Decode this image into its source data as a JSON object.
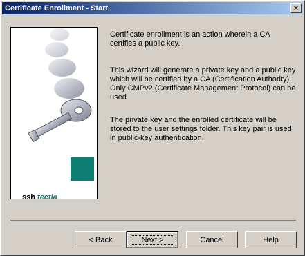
{
  "window": {
    "title": "Certificate Enrollment - Start",
    "close_label": "×"
  },
  "brand": {
    "logo_ssh": "ssh",
    "logo_tectia": "tectia"
  },
  "content": {
    "paragraphs": [
      "Certificate enrollment is an action wherein a CA certifies a public key.",
      "This wizard will generate a private key and a public key which will be certified by a CA (Certification Authority). Only CMPv2 (Certificate Management Protocol) can be used",
      "The private key and the enrolled certificate will be stored to the user settings folder. This key pair is used in public-key authentication."
    ]
  },
  "buttons": {
    "back_label": "< Back",
    "next_label": "Next >",
    "cancel_label": "Cancel",
    "help_label": "Help"
  },
  "colors": {
    "title_start": "#0a246a",
    "title_end": "#a6caf0",
    "brand": "#0e7d72"
  }
}
